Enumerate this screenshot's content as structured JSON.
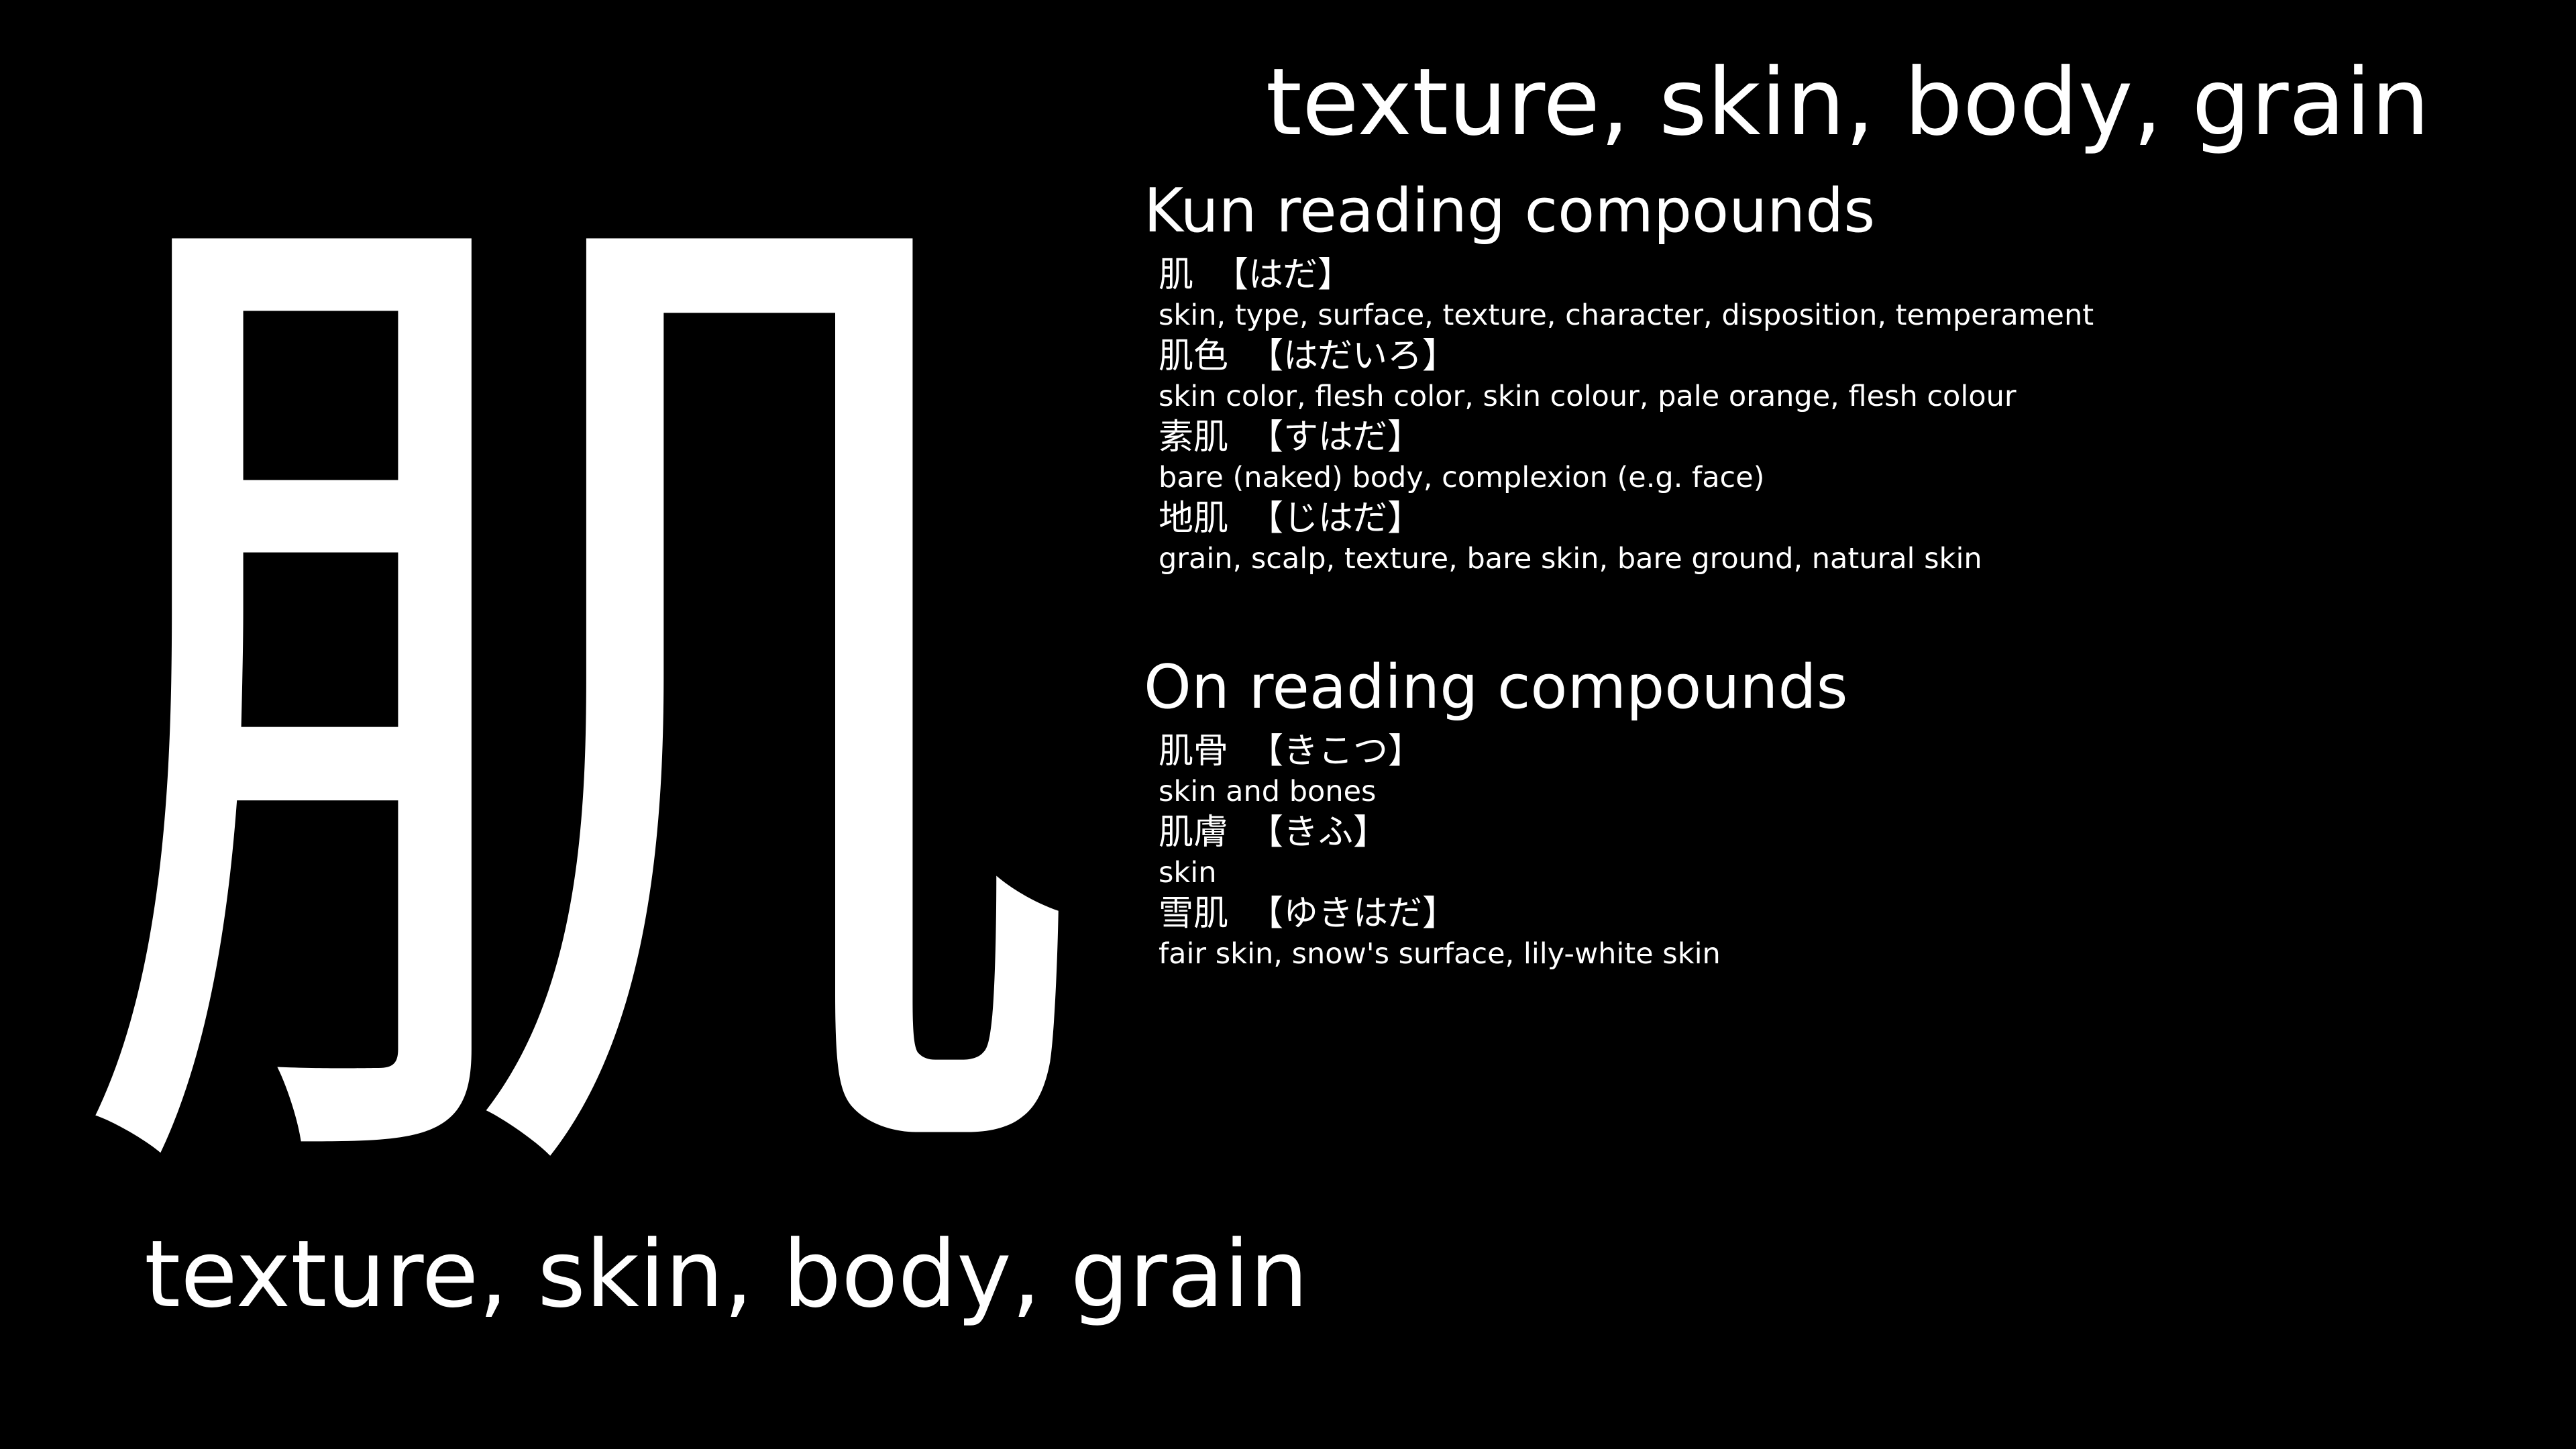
{
  "kanji": "肌",
  "meaning": "texture, skin, body, grain",
  "kun": {
    "title": "Kun reading compounds",
    "items": [
      {
        "word": "肌",
        "reading": "【はだ】",
        "gloss": "skin, type, surface, texture, character, disposition, temperament"
      },
      {
        "word": "肌色",
        "reading": "【はだいろ】",
        "gloss": "skin color, flesh color, skin colour, pale orange, flesh colour"
      },
      {
        "word": "素肌",
        "reading": "【すはだ】",
        "gloss": "bare (naked) body, complexion (e.g. face)"
      },
      {
        "word": "地肌",
        "reading": "【じはだ】",
        "gloss": "grain, scalp, texture, bare skin, bare ground, natural skin"
      }
    ]
  },
  "on": {
    "title": "On reading compounds",
    "items": [
      {
        "word": "肌骨",
        "reading": "【きこつ】",
        "gloss": "skin and bones"
      },
      {
        "word": "肌膚",
        "reading": "【きふ】",
        "gloss": "skin"
      },
      {
        "word": "雪肌",
        "reading": "【ゆきはだ】",
        "gloss": "fair skin, snow's surface, lily-white skin"
      }
    ]
  }
}
